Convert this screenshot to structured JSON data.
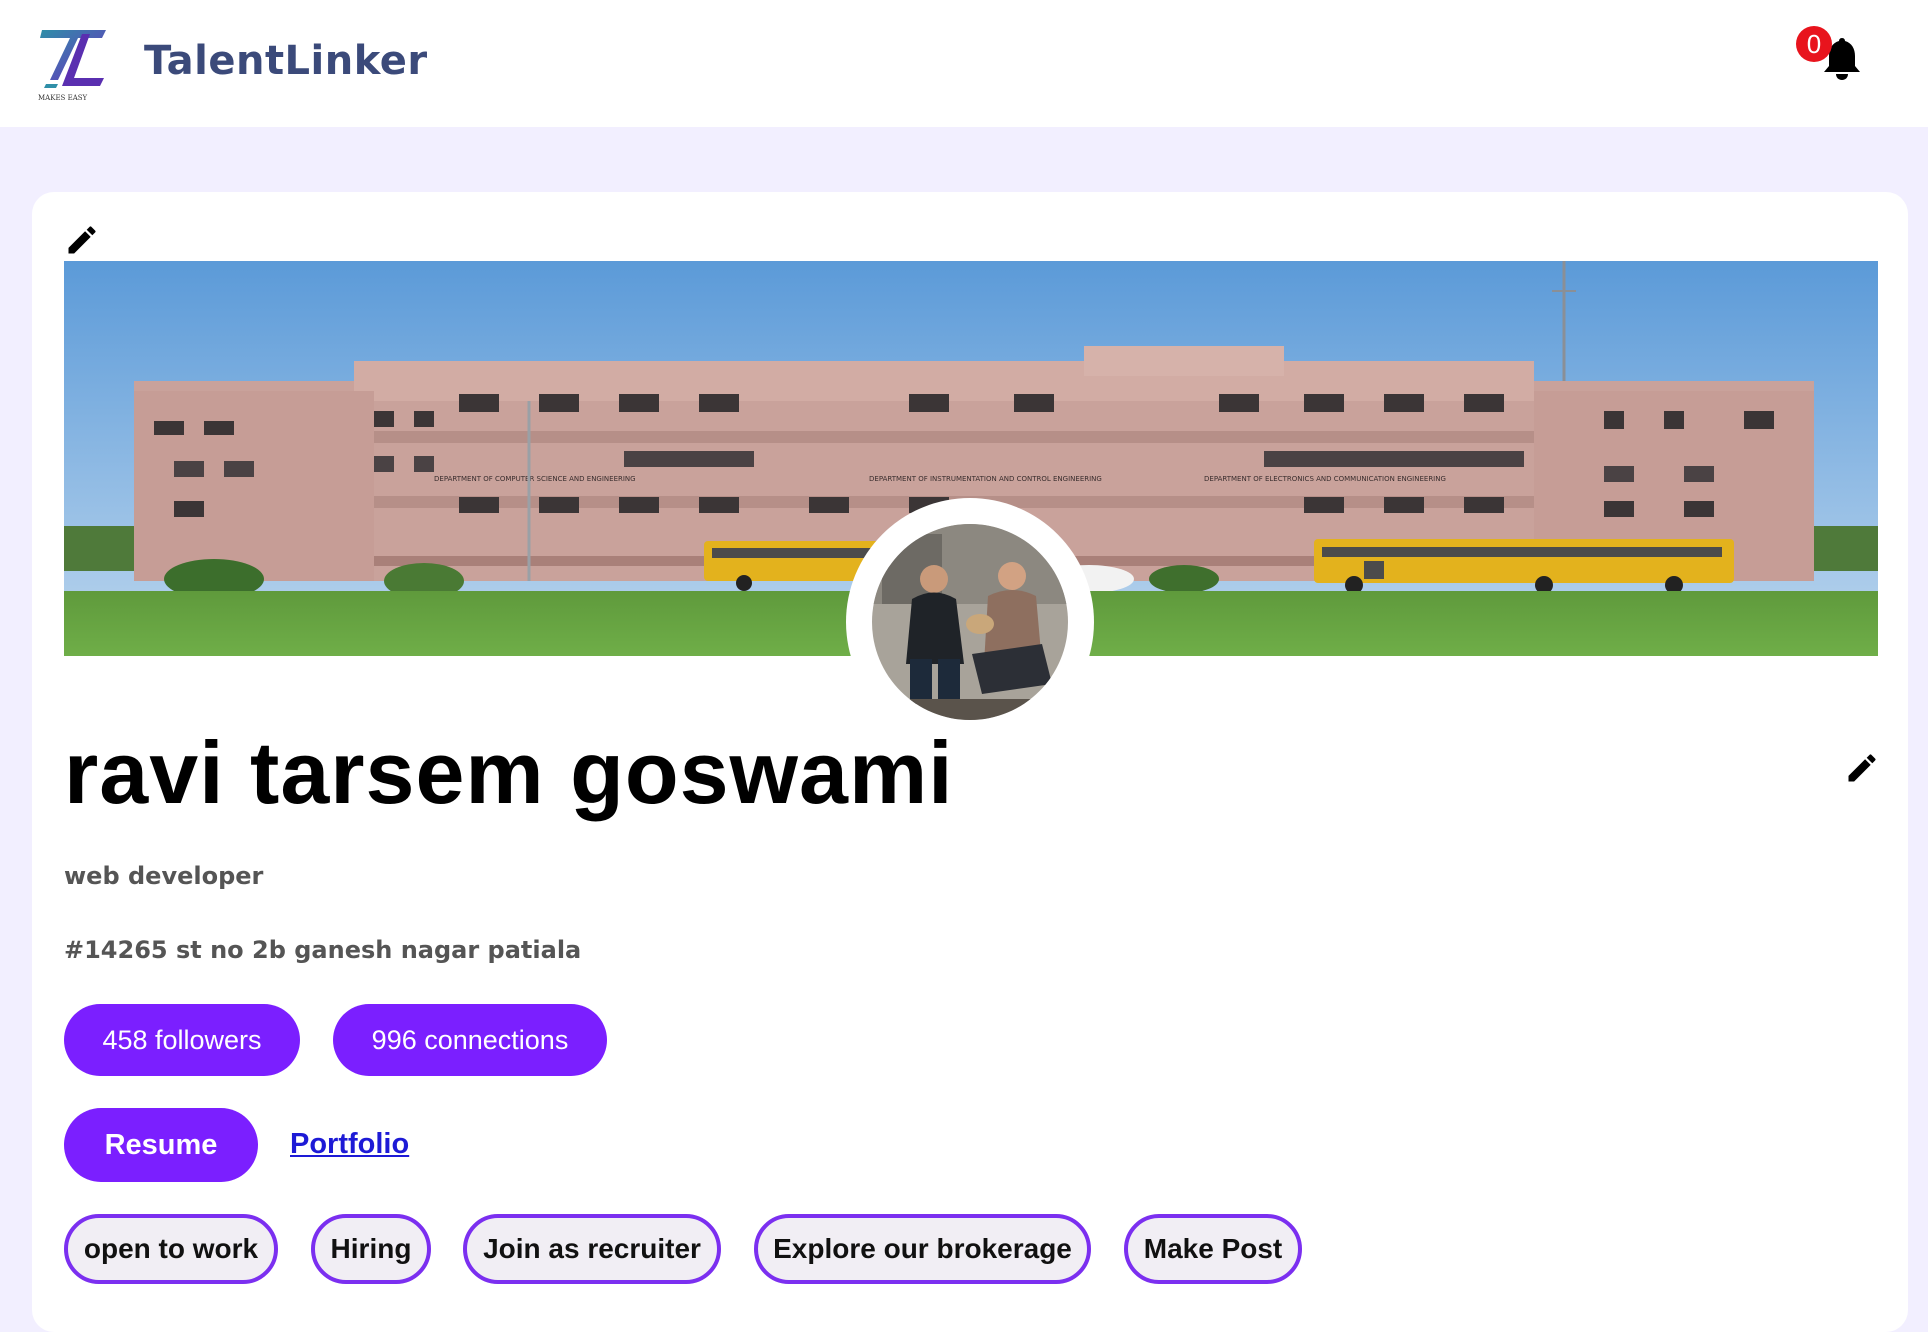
{
  "header": {
    "brand": "TalentLinker",
    "logo_tagline": "MAKES EASY",
    "notification_count": "0"
  },
  "profile": {
    "name": "ravi tarsem goswami",
    "headline": "web developer",
    "address": "#14265 st no 2b ganesh nagar patiala",
    "followers_label": "458 followers",
    "connections_label": "996 connections",
    "resume_label": "Resume",
    "portfolio_label": "Portfolio"
  },
  "cover": {
    "building_signs": [
      "DEPARTMENT OF COMPUTER SCIENCE AND ENGINEERING",
      "DEPARTMENT OF INSTRUMENTATION AND CONTROL ENGINEERING",
      "DEPARTMENT OF ELECTRONICS AND COMMUNICATION ENGINEERING"
    ]
  },
  "actions": [
    {
      "label": "open to work"
    },
    {
      "label": "Hiring"
    },
    {
      "label": "Join as recruiter"
    },
    {
      "label": "Explore our brokerage"
    },
    {
      "label": "Make Post"
    }
  ],
  "icons": {
    "logo": "talentlinker-logo-icon",
    "notifications": "bell-icon",
    "edit": "pencil-icon"
  },
  "colors": {
    "accent": "#7b1fff",
    "page_bg": "#f2efff",
    "badge": "#e8141d",
    "link": "#1d1ad6",
    "brand_text": "#3b4a7a"
  }
}
